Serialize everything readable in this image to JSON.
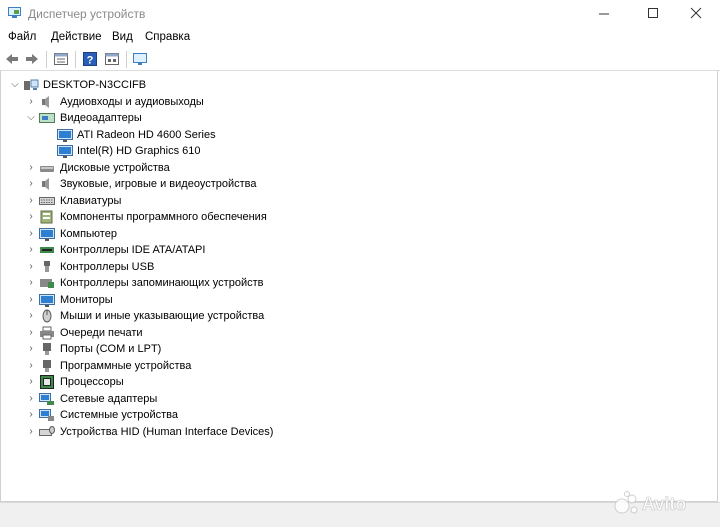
{
  "window": {
    "title": "Диспетчер устройств"
  },
  "menu": {
    "items": [
      "Файл",
      "Действие",
      "Вид",
      "Справка"
    ]
  },
  "toolbar": {
    "buttons": [
      "back",
      "forward",
      "properties",
      "help",
      "show-hidden",
      "monitor"
    ]
  },
  "tree": {
    "root": "DESKTOP-N3CCIFB",
    "categories": [
      {
        "label": "Аудиовходы и аудиовыходы",
        "icon": "speaker-icon",
        "expanded": false
      },
      {
        "label": "Видеоадаптеры",
        "icon": "display-adapter-icon",
        "expanded": true,
        "children": [
          "ATI Radeon HD 4600 Series",
          "Intel(R) HD Graphics 610"
        ]
      },
      {
        "label": "Дисковые устройства",
        "icon": "disk-drive-icon",
        "expanded": false
      },
      {
        "label": "Звуковые, игровые и видеоустройства",
        "icon": "sound-icon",
        "expanded": false
      },
      {
        "label": "Клавиатуры",
        "icon": "keyboard-icon",
        "expanded": false
      },
      {
        "label": "Компоненты программного обеспечения",
        "icon": "software-component-icon",
        "expanded": false
      },
      {
        "label": "Компьютер",
        "icon": "computer-icon",
        "expanded": false
      },
      {
        "label": "Контроллеры IDE ATA/ATAPI",
        "icon": "ide-controller-icon",
        "expanded": false
      },
      {
        "label": "Контроллеры USB",
        "icon": "usb-icon",
        "expanded": false
      },
      {
        "label": "Контроллеры запоминающих устройств",
        "icon": "storage-controller-icon",
        "expanded": false
      },
      {
        "label": "Мониторы",
        "icon": "monitor-icon",
        "expanded": false
      },
      {
        "label": "Мыши и иные указывающие устройства",
        "icon": "mouse-icon",
        "expanded": false
      },
      {
        "label": "Очереди печати",
        "icon": "printer-icon",
        "expanded": false
      },
      {
        "label": "Порты (COM и LPT)",
        "icon": "port-icon",
        "expanded": false
      },
      {
        "label": "Программные устройства",
        "icon": "software-device-icon",
        "expanded": false
      },
      {
        "label": "Процессоры",
        "icon": "processor-icon",
        "expanded": false
      },
      {
        "label": "Сетевые адаптеры",
        "icon": "network-adapter-icon",
        "expanded": false
      },
      {
        "label": "Системные устройства",
        "icon": "system-device-icon",
        "expanded": false
      },
      {
        "label": "Устройства HID (Human Interface Devices)",
        "icon": "hid-icon",
        "expanded": false
      }
    ]
  },
  "watermark": {
    "text": "Avito"
  },
  "colors": {
    "accent": "#2f7fd0",
    "tree_arrow": "#555555",
    "title_text": "#8a8a8a"
  }
}
